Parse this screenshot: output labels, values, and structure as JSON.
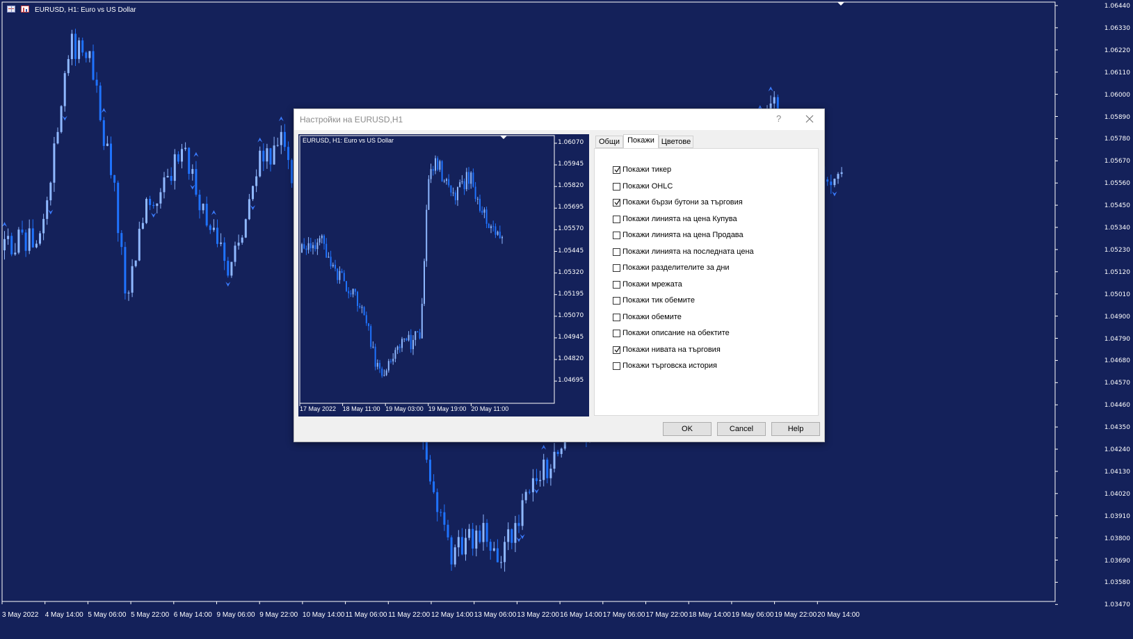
{
  "main_chart": {
    "title": "EURUSD, H1:  Euro vs US Dollar",
    "price_labels": [
      "1.06440",
      "1.06330",
      "1.06220",
      "1.06110",
      "1.06000",
      "1.05890",
      "1.05780",
      "1.05670",
      "1.05560",
      "1.05450",
      "1.05340",
      "1.05230",
      "1.05120",
      "1.05010",
      "1.04900",
      "1.04790",
      "1.04680",
      "1.04570",
      "1.04460",
      "1.04350",
      "1.04240",
      "1.04130",
      "1.04020",
      "1.03910",
      "1.03800",
      "1.03690",
      "1.03580",
      "1.03470"
    ],
    "time_labels": [
      "3 May 2022",
      "4 May 14:00",
      "5 May 06:00",
      "5 May 22:00",
      "6 May 14:00",
      "9 May 06:00",
      "9 May 22:00",
      "10 May 14:00",
      "11 May 06:00",
      "11 May 22:00",
      "12 May 14:00",
      "13 May 06:00",
      "13 May 22:00",
      "16 May 14:00",
      "17 May 06:00",
      "17 May 22:00",
      "18 May 14:00",
      "19 May 06:00",
      "19 May 22:00",
      "20 May 14:00"
    ],
    "colors": {
      "background": "#14215a",
      "bull": "#8fb8ff",
      "bear": "#1f73ff",
      "grid": "#ffffff"
    },
    "icons": [
      "table-icon",
      "bar-chart-icon"
    ]
  },
  "dialog": {
    "title": "Настройки на EURUSD,H1",
    "help_glyph": "?",
    "preview": {
      "title": "EURUSD, H1:  Euro vs US Dollar",
      "price_labels": [
        "1.06070",
        "1.05945",
        "1.05820",
        "1.05695",
        "1.05570",
        "1.05445",
        "1.05320",
        "1.05195",
        "1.05070",
        "1.04945",
        "1.04820",
        "1.04695"
      ],
      "time_labels": [
        "17 May 2022",
        "18 May 11:00",
        "19 May 03:00",
        "19 May 19:00",
        "20 May 11:00"
      ]
    },
    "tabs": [
      {
        "label": "Общи",
        "active": false
      },
      {
        "label": "Покажи",
        "active": true
      },
      {
        "label": "Цветове",
        "active": false
      }
    ],
    "options": [
      {
        "label": "Покажи тикер",
        "checked": true
      },
      {
        "label": "Покажи OHLC",
        "checked": false
      },
      {
        "label": "Покажи бързи бутони за търговия",
        "checked": true
      },
      {
        "label": "Покажи линията на цена Купува",
        "checked": false
      },
      {
        "label": "Покажи линията на цена Продава",
        "checked": false
      },
      {
        "label": "Покажи линията на последната цена",
        "checked": false
      },
      {
        "label": "Покажи разделителите за дни",
        "checked": false
      },
      {
        "label": "Покажи мрежата",
        "checked": false
      },
      {
        "label": "Покажи тик обемите",
        "checked": false
      },
      {
        "label": "Покажи обемите",
        "checked": false
      },
      {
        "label": "Покажи описание на обектите",
        "checked": false
      },
      {
        "label": "Покажи нивата на търговия",
        "checked": true
      },
      {
        "label": "Покажи търговска история",
        "checked": false
      }
    ],
    "buttons": {
      "ok": "OK",
      "cancel": "Cancel",
      "help": "Help"
    }
  }
}
